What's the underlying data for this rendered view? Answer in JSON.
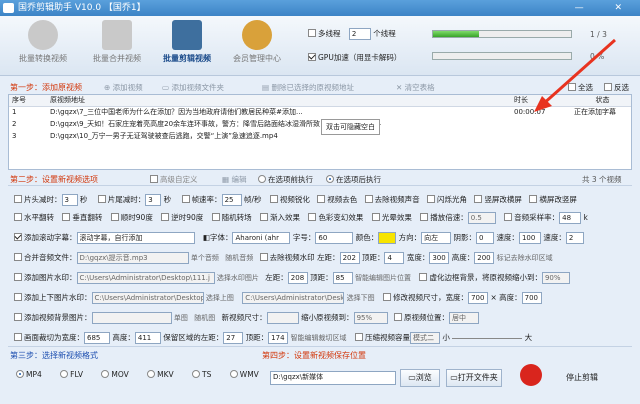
{
  "window": {
    "title": "国乔剪辑助手 V10.0 【国乔1】",
    "controls": "—  ✕"
  },
  "toolbar": {
    "items": [
      {
        "label": "批量转换视频",
        "icon": "convert-icon",
        "active": false
      },
      {
        "label": "批量合并视频",
        "icon": "merge-icon",
        "active": false
      },
      {
        "label": "批量剪辑视频",
        "icon": "film-icon",
        "active": true
      },
      {
        "label": "会员管理中心",
        "icon": "member-icon",
        "active": false
      }
    ]
  },
  "top": {
    "multithread": "多线程",
    "threads": "2",
    "threads_unit": "个线程",
    "gpu": "GPU加速（用显卡解码）",
    "progress1": 0.33,
    "progress1_text": "1 / 3",
    "progress2": 0.0,
    "progress2_text": "0 %"
  },
  "step1": {
    "title": "第一步：添加原视频",
    "add_video": "添加视频",
    "add_folder": "添加视频文件夹",
    "delete_selected": "删除已选择的原视频地址",
    "clear_table": "清空表格",
    "select_all": "全选",
    "invert": "反选"
  },
  "table": {
    "headers": [
      "序号",
      "原视频地址",
      "时长",
      "状态"
    ],
    "rows": [
      {
        "no": "1",
        "path": "D:\\gqzx\\7_三位中国老师为什么在添加？因为当地政府请他们教居民种菜#添加...",
        "duration": "00:00:07",
        "status": "正在添加字幕"
      },
      {
        "no": "2",
        "path": "D:\\gqzx\\9_天如！石家庄宠着亮高度20余车连环事故，警方：降雪后路面结冰湿滑所致 #连环事故？.mp4",
        "duration": "",
        "status": ""
      },
      {
        "no": "3",
        "path": "D:\\gqzx\\10_万宁一男子无证驾驶被查后逃跑，交警“上演”急速追逐.mp4",
        "duration": "",
        "status": ""
      }
    ],
    "tooltip": "双击可隐藏空白"
  },
  "step2": {
    "title": "第二步：设置新视频选项",
    "advanced": "高级自定义",
    "edit": "编辑",
    "before_add": "在选项前执行",
    "after_add": "在选项后执行",
    "count": "共 3 个视频"
  },
  "opts": {
    "head_cut": "片头减时：",
    "head_val": "3",
    "sec": "秒",
    "tail_cut": "片尾减时：",
    "tail_val": "3",
    "frame_rate": "帧速率：",
    "frame_val": "25",
    "fps": "帧/秒",
    "sharpen": "视频锐化",
    "denoise": "视频去色",
    "remove_audio": "去除视频声音",
    "flash": "闪烁光角",
    "vertical": "竖屏改横屏",
    "horizontal": "横屏改竖屏",
    "hflip": "水平翻转",
    "vflip": "垂直翻转",
    "rot90": "顺时90度",
    "rot_ccw": "逆时90度",
    "random_trans": "随机转场",
    "fade_in": "渐入效果",
    "color_enhance": "色彩变幻效果",
    "light": "光晕效果",
    "speed": "播放倍速：",
    "speed_val": "0.5",
    "sample_rate": "音频采样率：",
    "sample_val": "48",
    "k": "k",
    "add_subtitle": "添加滚动字幕：",
    "subtitle_text": "滚动字幕，自行添加",
    "font": "字体：",
    "font_val": "Aharoni (ahr",
    "size": "字号：",
    "size_val": "60",
    "color": "颜色：",
    "direction": "方向：",
    "dir_val": "向左",
    "shadow": "阴影：",
    "shadow_val": "0",
    "speed2": "速度：",
    "speed2_val": "100",
    "stroke_speed": "速度：",
    "stroke_val": "2",
    "merge_audio": "合并音频文件：",
    "audio_path": "D:\\gqzx\\提示音.mp3",
    "single_audio": "单个音频",
    "random_audio": "随机音频",
    "remove_watermark": "去除视频水印",
    "left": "左距：",
    "left_val": "202",
    "top": "顶距：",
    "top_val": "4",
    "width": "宽度：",
    "width_val": "300",
    "height": "高度：",
    "height_val": "200",
    "mark_region": "标记去除水印区域",
    "add_image_wm": "添加图片水印：",
    "image_path": "C:\\Users\\Administrator\\Desktop\\111.j",
    "select_img": "选择水印图片",
    "left2": "左距：",
    "left2_val": "208",
    "top2": "顶距：",
    "top2_val": "85",
    "smart_pos": "智能编辑图片位置",
    "blur_edge": "虚化边框背景，将原视频缩小到：",
    "blur_val": "90%",
    "add_frame": "添加上下图片水印：",
    "frame_path": "C:\\Users\\Administrator\\Desktop\\",
    "sel_top": "选择上图",
    "bottom_path": "C:\\Users\\Administrator\\Desk",
    "sel_bottom": "选择下图",
    "modify_size": "修改视频尺寸，宽度：",
    "w_val": "700",
    "x": "×",
    "h_label": "高度：",
    "h_val": "700",
    "add_bg": "添加视频背景图片：",
    "bg_sel": "单图",
    "bg_random": "随机图",
    "new_size": "新视频尺寸：",
    "scale": "缩小原视频到：",
    "scale_val": "95%",
    "orig_pos": "原视频位置：",
    "pos_val": "居中",
    "crop": "画面裁切为宽度：",
    "crop_w": "685",
    "crop_h_label": "高度：",
    "crop_h": "411",
    "keep": "保留区域的左距：",
    "keep_left": "27",
    "keep_top_label": "顶距：",
    "keep_top": "174",
    "smart_crop": "智能编辑裁切区域",
    "compress": "压缩视频容量",
    "mode": "模式二",
    "size_small": "小",
    "size_large": "大"
  },
  "step3": {
    "title": "第三步：选择新视频格式",
    "formats": [
      "MP4",
      "FLV",
      "MOV",
      "MKV",
      "TS",
      "WMV"
    ],
    "selected": "MP4"
  },
  "step4": {
    "title": "第四步：设置新视频保存位置",
    "path": "D:\\gqzx\\新媒体",
    "browse": "浏览",
    "open_folder": "打开文件夹",
    "stop": "停止剪辑"
  },
  "colors": {
    "accent": "#1c5fb8",
    "step_red": "#d2370b",
    "subtitle_color": "#f7e400",
    "stop": "#d9251d"
  }
}
